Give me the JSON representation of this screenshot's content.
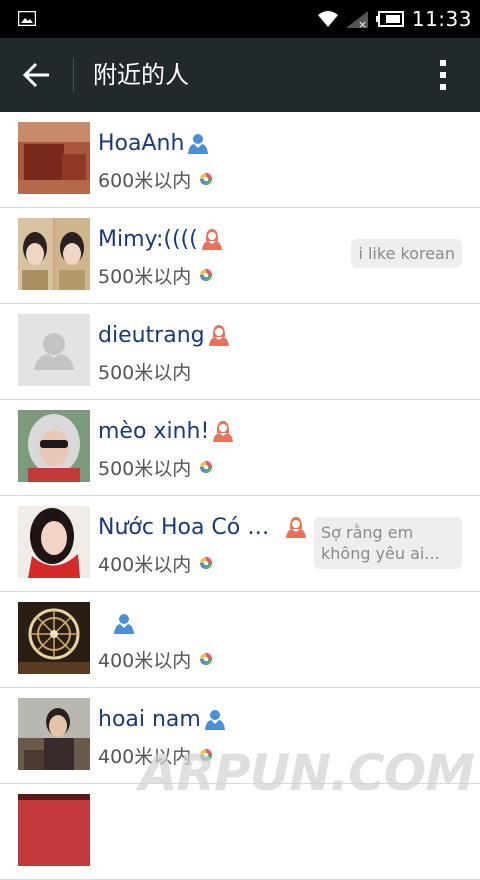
{
  "status_bar": {
    "time": "11:33"
  },
  "app_bar": {
    "title": "附近的人"
  },
  "colors": {
    "male": "#4a90d9",
    "female": "#e8735a",
    "name": "#1a3a7a",
    "app_bar": "#22292c"
  },
  "people": [
    {
      "name": "HoaAnh",
      "gender": "male",
      "distance": "600米以内",
      "moments": true,
      "signature": ""
    },
    {
      "name": "Mimy:((((",
      "gender": "female",
      "distance": "500米以内",
      "moments": true,
      "signature": "i like korean"
    },
    {
      "name": "dieutrang",
      "gender": "female",
      "distance": "500米以内",
      "moments": false,
      "signature": ""
    },
    {
      "name": "mèo xinh!",
      "gender": "female",
      "distance": "500米以内",
      "moments": true,
      "signature": ""
    },
    {
      "name": "Nước Hoa Có Đ...",
      "gender": "female",
      "distance": "400米以内",
      "moments": true,
      "signature": "Sợ rằng em không yêu ai..."
    },
    {
      "name": "",
      "gender": "male",
      "distance": "400米以内",
      "moments": true,
      "signature": ""
    },
    {
      "name": "hoai nam",
      "gender": "male",
      "distance": "400米以内",
      "moments": true,
      "signature": ""
    }
  ],
  "watermark": "ARPUN.COM"
}
